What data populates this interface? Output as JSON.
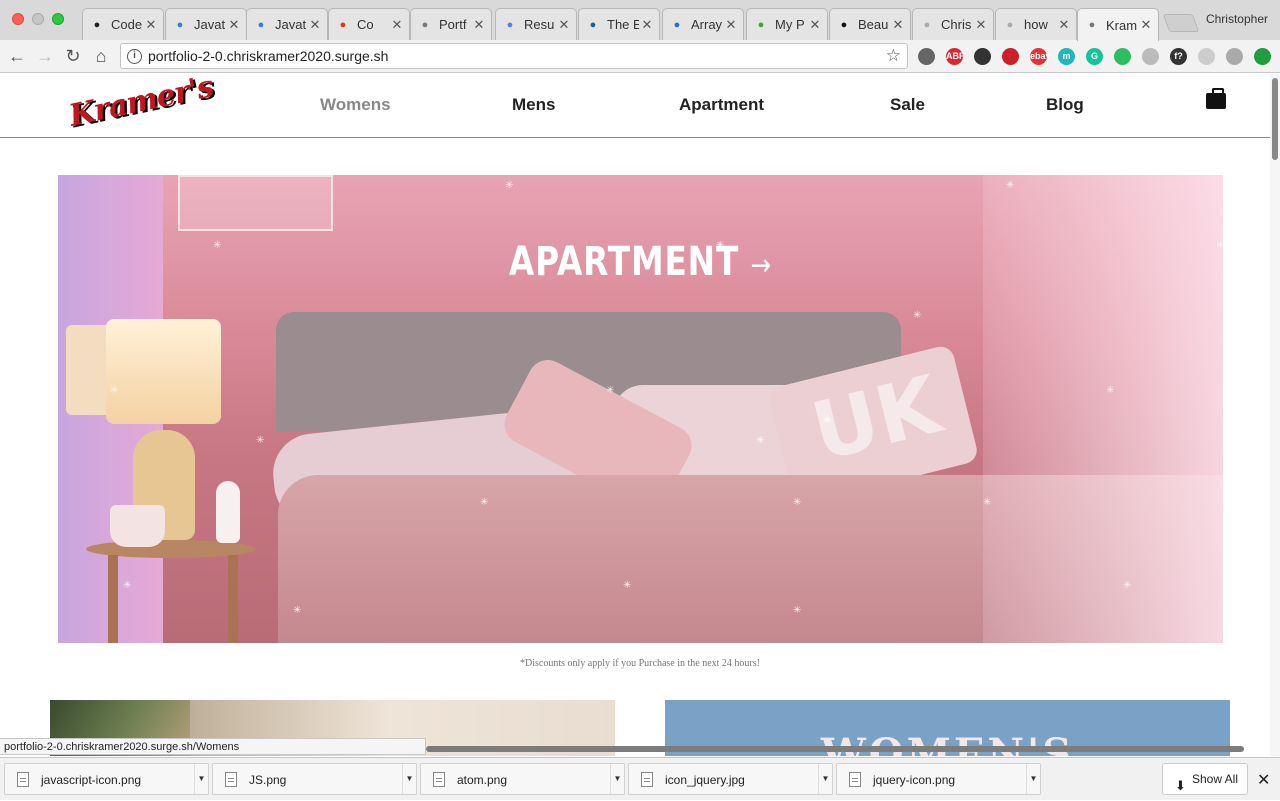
{
  "browser": {
    "tabs": [
      {
        "title": "Code",
        "favicon": "codepen-icon",
        "fav_color": "#222"
      },
      {
        "title": "Javat",
        "favicon": "code-icon",
        "fav_color": "#3a7bd5"
      },
      {
        "title": "Javat",
        "favicon": "code-icon",
        "fav_color": "#3a7bd5"
      },
      {
        "title": "Co",
        "favicon": "youtube-icon",
        "fav_color": "#e52d27"
      },
      {
        "title": "Portf",
        "favicon": "page-icon",
        "fav_color": "#777"
      },
      {
        "title": "Resu",
        "favicon": "docs-icon",
        "fav_color": "#4285f4"
      },
      {
        "title": "The E",
        "favicon": "xing-icon",
        "fav_color": "#1f5e8a"
      },
      {
        "title": "Array",
        "favicon": "codewars-icon",
        "fav_color": "#2f6fb5"
      },
      {
        "title": "My P",
        "favicon": "sheet-icon",
        "fav_color": "#4a9b3f"
      },
      {
        "title": "Beau",
        "favicon": "uo-icon",
        "fav_color": "#111"
      },
      {
        "title": "Chris",
        "favicon": "loading-icon",
        "fav_color": "#aaa"
      },
      {
        "title": "how",
        "favicon": "loading-icon",
        "fav_color": "#aaa"
      },
      {
        "title": "Kram",
        "favicon": "page-icon",
        "fav_color": "#777"
      }
    ],
    "profile": "Christopher",
    "url": "portfolio-2-0.chriskramer2020.surge.sh",
    "status_url": "portfolio-2-0.chriskramer2020.surge.sh/Womens",
    "extensions": [
      {
        "name": "cast-icon",
        "color": "#666"
      },
      {
        "name": "adblock-icon",
        "color": "#d8272e",
        "label": "ABP"
      },
      {
        "name": "buffer-icon",
        "color": "#333"
      },
      {
        "name": "pinterest-icon",
        "color": "#cb2027"
      },
      {
        "name": "ebay-icon",
        "color": "#e53238",
        "label": "ebay"
      },
      {
        "name": "m-icon",
        "color": "#1fb7b7",
        "label": "m"
      },
      {
        "name": "grammarly-icon",
        "color": "#15c39a",
        "label": "G"
      },
      {
        "name": "evernote-icon",
        "color": "#2dbe60"
      },
      {
        "name": "pattern-icon",
        "color": "#bbb"
      },
      {
        "name": "font-icon",
        "color": "#333",
        "label": "f?"
      },
      {
        "name": "drop-icon",
        "color": "#ccc"
      },
      {
        "name": "tag-icon",
        "color": "#aaa"
      },
      {
        "name": "upload-icon",
        "color": "#1e9e3c"
      }
    ]
  },
  "site": {
    "logo": "Kramer's",
    "nav": [
      "Womens",
      "Mens",
      "Apartment",
      "Sale",
      "Blog"
    ],
    "hero_title": "APARTMENT",
    "hero_arrow": "→",
    "hero_product_text": "UK",
    "disclaimer": "*Discounts only apply if you Purchase in the next 24 hours!",
    "card_right_text": "WOMEN'S"
  },
  "downloads": {
    "items": [
      "javascript-icon.png",
      "JS.png",
      "atom.png",
      "icon_jquery.jpg",
      "jquery-icon.png"
    ],
    "show_all": "Show All"
  },
  "colors": {
    "brand_red": "#c0171e",
    "nav_active": "#888888",
    "hero_tint": "#d88896"
  }
}
